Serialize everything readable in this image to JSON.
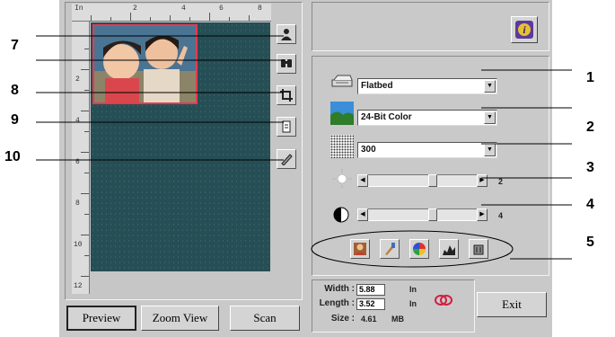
{
  "ruler": {
    "top_labels": [
      "In",
      "2",
      "4",
      "6",
      "8"
    ],
    "left_labels": [
      "2",
      "4",
      "6",
      "8",
      "10",
      "12"
    ]
  },
  "callouts": {
    "left": [
      "7",
      "8",
      "9",
      "10"
    ],
    "right": [
      "1",
      "2",
      "3",
      "4",
      "5"
    ]
  },
  "sidebar_tools": [
    {
      "icon": "person-silhouette-icon"
    },
    {
      "icon": "binoculars-icon"
    },
    {
      "icon": "crop-icon"
    },
    {
      "icon": "page-icon"
    },
    {
      "icon": "pencil-icon"
    }
  ],
  "scan_settings": {
    "source": {
      "value": "Flatbed",
      "icon": "scanner-icon"
    },
    "mode": {
      "value": "24-Bit Color",
      "icon": "landscape-icon"
    },
    "resolution": {
      "value": "300",
      "icon": "halftone-icon"
    },
    "brightness": {
      "value": "2",
      "icon": "sun-icon",
      "level": 0.6
    },
    "contrast": {
      "value": "4",
      "icon": "contrast-icon",
      "level": 0.6
    }
  },
  "tools_bar": [
    {
      "icon": "portrait-icon"
    },
    {
      "icon": "brush-icon"
    },
    {
      "icon": "color-wheel-icon"
    },
    {
      "icon": "histogram-icon"
    },
    {
      "icon": "delete-icon"
    }
  ],
  "dimensions": {
    "width_label": "Width :",
    "width_value": "5.88",
    "width_unit": "In",
    "length_label": "Length :",
    "length_value": "3.52",
    "length_unit": "In",
    "size_label": "Size :",
    "size_value": "4.61",
    "size_unit": "MB"
  },
  "buttons": {
    "preview": "Preview",
    "zoom_view": "Zoom View",
    "scan": "Scan",
    "exit": "Exit"
  },
  "colors": {
    "preview_bg": "#264e55",
    "selection_border": "#e8394f",
    "info_button": "#5b3b9a"
  }
}
